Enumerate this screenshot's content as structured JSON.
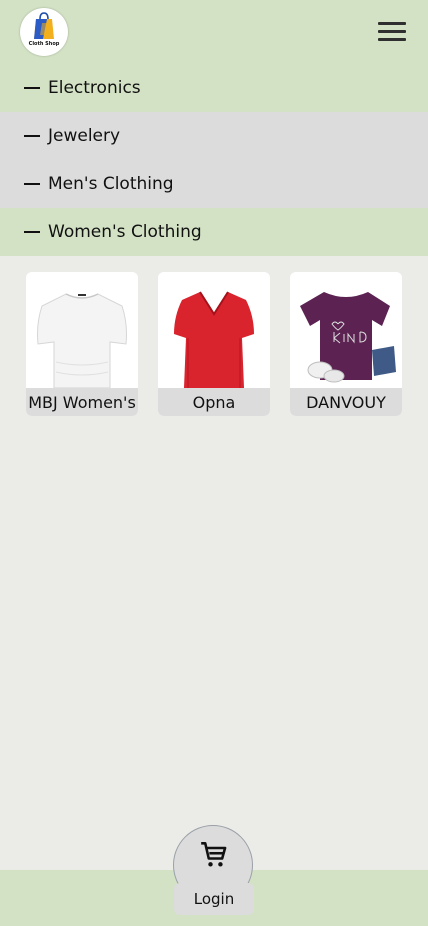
{
  "header": {
    "logo_text": "Cloth Shop",
    "menu_icon": "hamburger-menu-icon"
  },
  "categories": [
    {
      "label": "Electronics",
      "active": false
    },
    {
      "label": "Jewelery",
      "active": false
    },
    {
      "label": "Men's Clothing",
      "active": false
    },
    {
      "label": "Women's Clothing",
      "active": true
    }
  ],
  "products": [
    {
      "name": "MBJ Women's",
      "image": "white-top"
    },
    {
      "name": "Opna",
      "image": "red-v-neck-shirt"
    },
    {
      "name": "DANVOUY",
      "image": "purple-be-kind-tshirt"
    }
  ],
  "footer": {
    "cart_icon": "shopping-cart-icon",
    "login_label": "Login"
  },
  "colors": {
    "header_green": "#d3e2c5",
    "background": "#ebece7",
    "grey": "#dcdcdc"
  }
}
